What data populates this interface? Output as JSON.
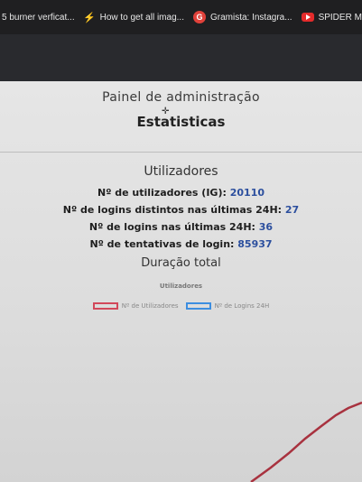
{
  "bookmarks": [
    {
      "label": "5 burner verficat...",
      "icon": "none"
    },
    {
      "label": "How to get all imag...",
      "icon": "bolt-icon"
    },
    {
      "label": "Gramista: Instagra...",
      "icon": "g-icon",
      "icon_text": "G"
    },
    {
      "label": "SPIDER M",
      "icon": "youtube-icon"
    }
  ],
  "panel": {
    "admin_title": "Painel de administração",
    "stats_title": "Estatisticas"
  },
  "users_section": {
    "title": "Utilizadores",
    "stats": [
      {
        "label": "Nº de utilizadores (IG):",
        "value": "20110"
      },
      {
        "label": "Nº de logins distintos nas últimas 24H:",
        "value": "27"
      },
      {
        "label": "Nº de logins nas últimas 24H:",
        "value": "36"
      },
      {
        "label": "Nº de tentativas de login:",
        "value": "85937"
      }
    ]
  },
  "duration": {
    "title": "Duração total"
  },
  "chart": {
    "caption": "Utilizadores",
    "legend": [
      {
        "label": "Nº de Utilizadores",
        "color": "#d2485a"
      },
      {
        "label": "Nº de Logins 24H",
        "color": "#3d8ee0"
      }
    ]
  },
  "chart_data": {
    "type": "line",
    "title": "Utilizadores",
    "series": [
      {
        "name": "Nº de Utilizadores",
        "color": "#d2485a",
        "trend": "increasing"
      },
      {
        "name": "Nº de Logins 24H",
        "color": "#3d8ee0"
      }
    ]
  },
  "colors": {
    "value_blue": "#2c4f9e",
    "header_dark": "#292a2e",
    "bookmarks_bg": "#1f1f21"
  }
}
